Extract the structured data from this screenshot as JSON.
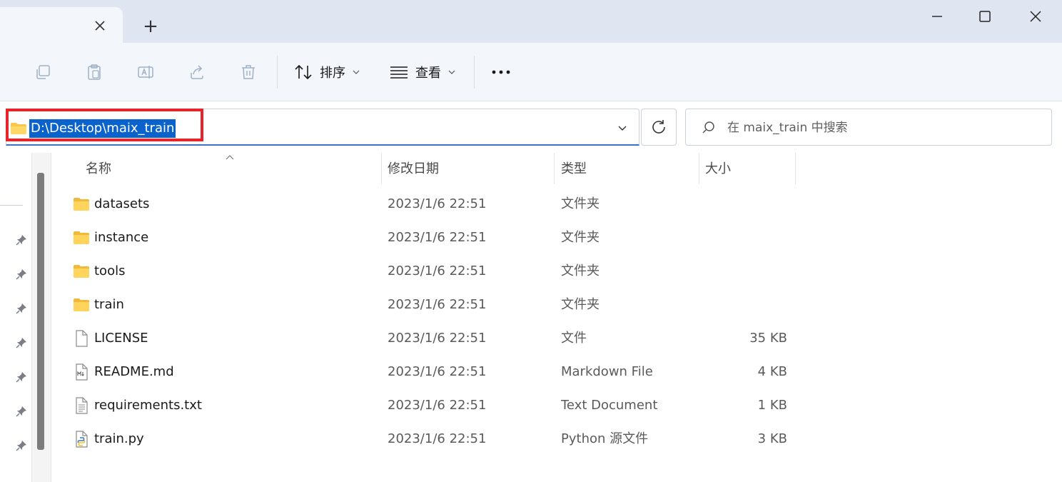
{
  "titlebar": {
    "new_tab_label": "+"
  },
  "toolbar": {
    "sort_label": "排序",
    "view_label": "查看"
  },
  "address": {
    "path": "D:\\Desktop\\maix_train"
  },
  "search": {
    "placeholder": "在 maix_train 中搜索"
  },
  "columns": {
    "name": "名称",
    "modified": "修改日期",
    "type": "类型",
    "size": "大小"
  },
  "files": [
    {
      "name": "datasets",
      "modified": "2023/1/6 22:51",
      "type": "文件夹",
      "size": "",
      "icon": "folder-icon"
    },
    {
      "name": "instance",
      "modified": "2023/1/6 22:51",
      "type": "文件夹",
      "size": "",
      "icon": "folder-icon"
    },
    {
      "name": "tools",
      "modified": "2023/1/6 22:51",
      "type": "文件夹",
      "size": "",
      "icon": "folder-icon"
    },
    {
      "name": "train",
      "modified": "2023/1/6 22:51",
      "type": "文件夹",
      "size": "",
      "icon": "folder-icon"
    },
    {
      "name": "LICENSE",
      "modified": "2023/1/6 22:51",
      "type": "文件",
      "size": "35 KB",
      "icon": "file-icon"
    },
    {
      "name": "README.md",
      "modified": "2023/1/6 22:51",
      "type": "Markdown File",
      "size": "4 KB",
      "icon": "markdown-file-icon"
    },
    {
      "name": "requirements.txt",
      "modified": "2023/1/6 22:51",
      "type": "Text Document",
      "size": "1 KB",
      "icon": "text-file-icon"
    },
    {
      "name": "train.py",
      "modified": "2023/1/6 22:51",
      "type": "Python 源文件",
      "size": "3 KB",
      "icon": "python-file-icon"
    }
  ],
  "colors": {
    "accent": "#0a63cc",
    "highlight_box": "#e8242b",
    "folder": "#f8c74a"
  }
}
